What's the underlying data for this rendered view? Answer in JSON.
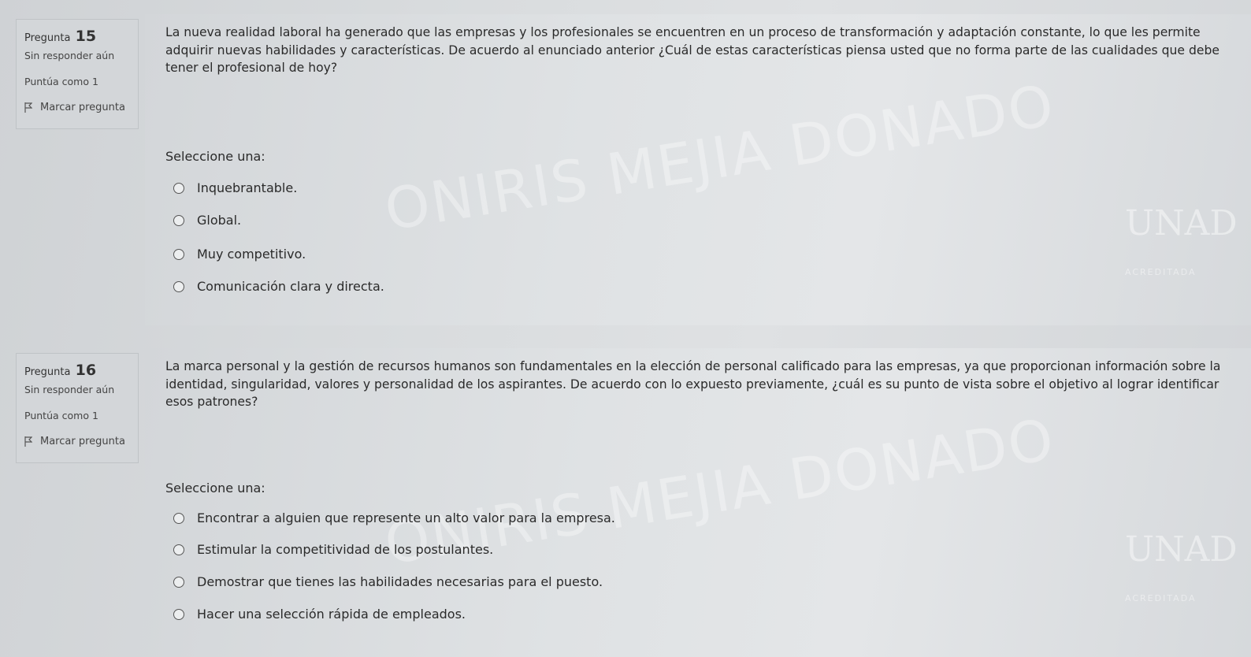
{
  "questions": [
    {
      "label": "Pregunta",
      "number": "15",
      "status": "Sin responder aún",
      "score": "Puntúa como 1",
      "flag": "Marcar pregunta",
      "text": "La nueva realidad laboral ha generado que las empresas y los profesionales se encuentren en un proceso de transformación y adaptación constante, lo que les permite adquirir nuevas habilidades y características. De acuerdo al enunciado anterior ¿Cuál de estas características piensa usted que no forma parte de las cualidades que debe tener el profesional de hoy?",
      "prompt": "Seleccione una:",
      "options": [
        "Inquebrantable.",
        "Global.",
        "Muy competitivo.",
        "Comunicación clara y directa."
      ],
      "watermark": "ONIRIS MEJIA DONADO",
      "logo": "UNAD",
      "logo_sub": "ACREDITADA"
    },
    {
      "label": "Pregunta",
      "number": "16",
      "status": "Sin responder aún",
      "score": "Puntúa como 1",
      "flag": "Marcar pregunta",
      "text": "La marca personal y la gestión de recursos humanos son fundamentales en la elección de personal calificado para las empresas, ya que proporcionan información sobre la identidad, singularidad, valores y personalidad de los aspirantes. De acuerdo con lo expuesto previamente, ¿cuál es su punto de vista sobre el objetivo al lograr identificar esos patrones?",
      "prompt": "Seleccione una:",
      "options": [
        "Encontrar a alguien que represente un alto valor para la empresa.",
        "Estimular la competitividad de los postulantes.",
        "Demostrar que tienes las habilidades necesarias para el puesto.",
        "Hacer una selección rápida de empleados."
      ],
      "watermark": "ONIRIS MEJIA DONADO",
      "logo": "UNAD",
      "logo_sub": "ACREDITADA"
    }
  ]
}
